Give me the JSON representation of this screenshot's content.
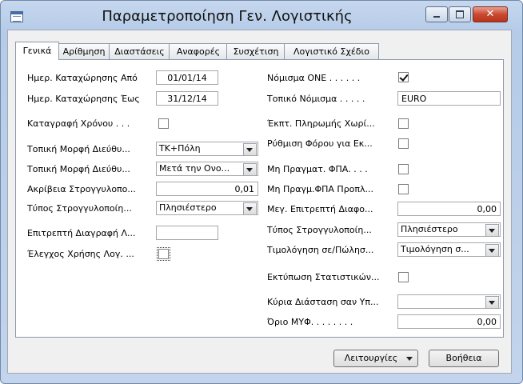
{
  "window": {
    "title": "Παραμετροποίηση Γεν. Λογιστικής",
    "close_glyph": "✕"
  },
  "tabs": [
    {
      "label": "Γενικά",
      "active": true
    },
    {
      "label": "Αρίθμηση",
      "active": false
    },
    {
      "label": "Διαστάσεις",
      "active": false
    },
    {
      "label": "Αναφορές",
      "active": false
    },
    {
      "label": "Συσχέτιση",
      "active": false
    },
    {
      "label": "Λογιστικό Σχέδιο",
      "active": false
    }
  ],
  "left": {
    "posting_from_label": "Ημερ. Καταχώρησης Από",
    "posting_from_value": "01/01/14",
    "posting_to_label": "Ημερ. Καταχώρησης Έως",
    "posting_to_value": "31/12/14",
    "register_time_label": "Καταγραφή Χρόνου . . .",
    "register_time_checked": false,
    "local_address1_label": "Τοπική Μορφή Διεύθυ...",
    "local_address1_value": "ΤΚ+Πόλη",
    "local_address2_label": "Τοπική Μορφή Διεύθυ...",
    "local_address2_value": "Μετά την Ονο...",
    "rounding_precision_label": "Ακρίβεια Στρογγυλοπο...",
    "rounding_precision_value": "0,01",
    "rounding_type_label": "Τύπος Στρογγυλοποίη...",
    "rounding_type_value": "Πλησιέστερο",
    "allow_delete_label": "Επιτρεπτή Διαγραφή Λ...",
    "allow_delete_value": "",
    "check_account_usage_label": "Έλεγχος Χρήσης Λογ. ...",
    "check_account_usage_checked": false
  },
  "right": {
    "lcy_label": "Νόμισμα ΟΝΕ . . . . . .",
    "lcy_checked": true,
    "local_currency_label": "Τοπικό Νόμισμα . . . . .",
    "local_currency_value": "EURO",
    "payment_discount_label": "Έκπτ. Πληρωμής Χωρί...",
    "payment_discount_checked": false,
    "tax_adjust_label": "Ρύθμιση Φόρου για Εκ...",
    "tax_adjust_checked": false,
    "unrealized_vat_label": "Μη Πραγματ. ΦΠΑ. . . .",
    "unrealized_vat_checked": false,
    "unrealized_prepay_vat_label": "Μη Πραγμ.ΦΠΑ Προπλ...",
    "unrealized_prepay_vat_checked": false,
    "max_diff_label": "Μεγ. Επιτρεπτή Διαφο...",
    "max_diff_value": "0,00",
    "rounding_type_label": "Τύπος Στρογγυλοποίη...",
    "rounding_type_value": "Πλησιέστερο",
    "invoicing_label": "Τιμολόγηση σε/Πώλησ...",
    "invoicing_value": "Τιμολόγηση σ...",
    "print_stats_label": "Εκτύπωση Στατιστικών...",
    "print_stats_checked": false,
    "main_dimension_label": "Κύρια Διάσταση σαν Υπ...",
    "main_dimension_value": "",
    "myf_limit_label": "Όριο ΜΥΦ. . . . . . . .",
    "myf_limit_value": "0,00"
  },
  "buttons": {
    "functions_label": "Λειτουργίες",
    "help_label": "Βοήθεια"
  }
}
